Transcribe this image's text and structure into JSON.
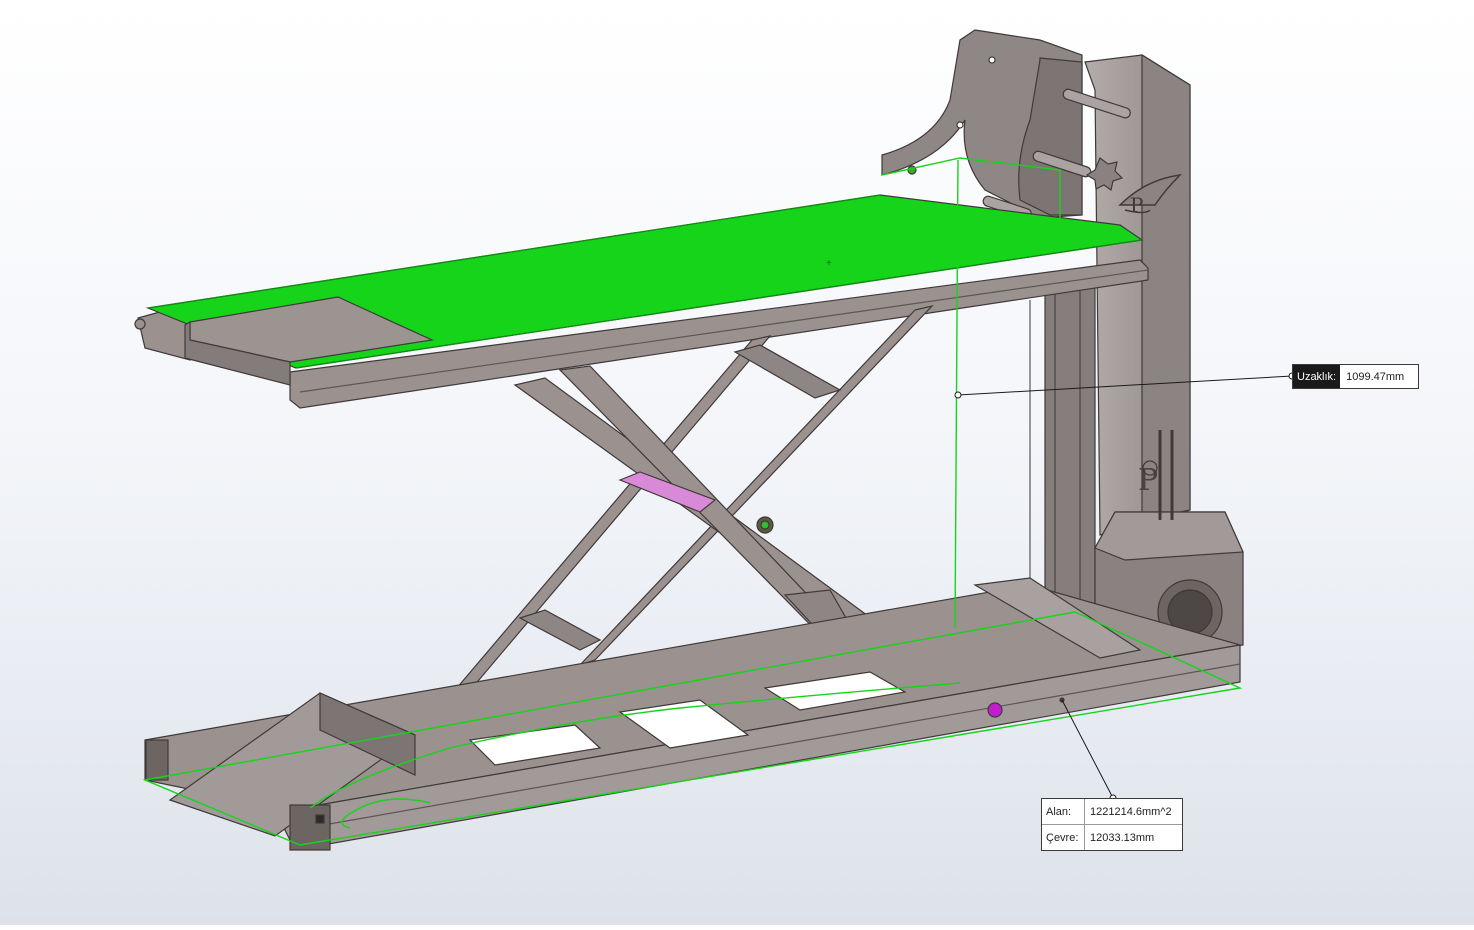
{
  "colors": {
    "steel": "#9b9290",
    "steel_dark": "#6d6562",
    "steel_edge": "#3f3a39",
    "selection_green": "#16d41a",
    "pink": "#d98ad6",
    "magenta": "#c21ed0"
  },
  "measurement_distance": {
    "label": "Uzaklık:",
    "value": "1099.47mm"
  },
  "measurement_area": {
    "area_label": "Alan:",
    "area_value": "1221214.6mm^2",
    "perimeter_label": "Çevre:",
    "perimeter_value": "12033.13mm"
  }
}
